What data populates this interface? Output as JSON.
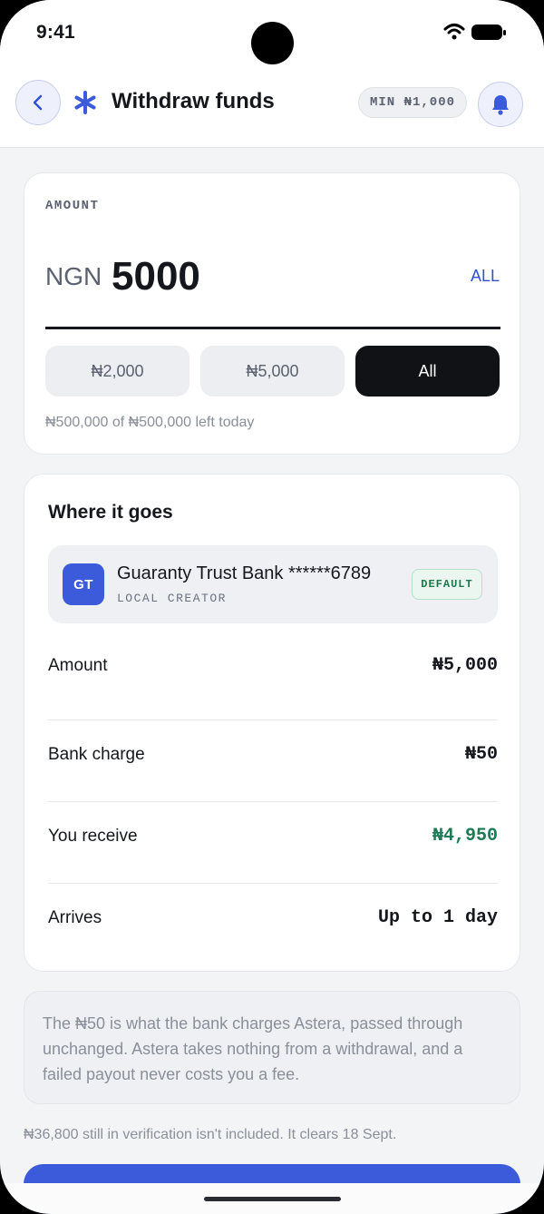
{
  "status_bar": {
    "time": "9:41"
  },
  "header": {
    "title": "Withdraw funds",
    "min_label": "MIN ₦1,000"
  },
  "amount": {
    "label": "AMOUNT",
    "currency": "NGN",
    "value": "5000",
    "all_link": "ALL",
    "chips": [
      "₦2,000",
      "₦5,000",
      "All"
    ],
    "selected_chip": "All",
    "limit_text": "₦500,000 of ₦500,000 left today"
  },
  "destination": {
    "title": "Where it goes",
    "bank": {
      "logo": "GT",
      "name": "Guaranty Trust Bank ******6789",
      "type": "LOCAL CREATOR",
      "badge": "DEFAULT"
    },
    "rows": [
      {
        "label": "Amount",
        "value": "₦5,000"
      },
      {
        "label": "Bank charge",
        "value": "₦50"
      },
      {
        "label": "You receive",
        "value": "₦4,950"
      },
      {
        "label": "Arrives",
        "value": "Up to 1 day"
      }
    ]
  },
  "note": "The ₦50 is what the bank charges Astera, passed through unchanged. Astera takes nothing from a withdrawal, and a failed payout never costs you a fee.",
  "footer_note": "₦36,800 still in verification isn't included. It clears 18 Sept.",
  "colors": {
    "accent": "#3b5bdb",
    "positive": "#1d7a55",
    "dark_chip": "#101215",
    "background": "#f3f4f6"
  }
}
